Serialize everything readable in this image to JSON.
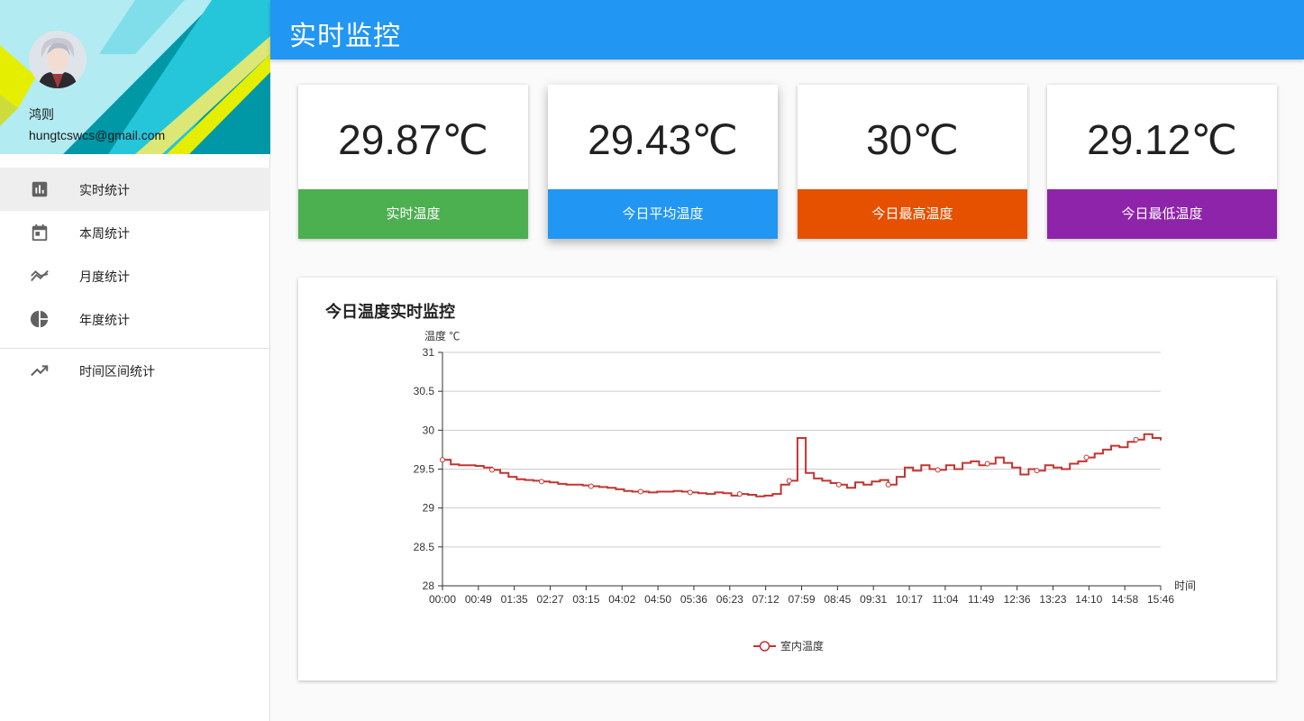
{
  "user": {
    "name": "鸿则",
    "email": "hungtcswcs@gmail.com"
  },
  "nav": [
    {
      "label": "实时统计",
      "icon": "bar-chart-icon",
      "active": true
    },
    {
      "label": "本周统计",
      "icon": "calendar-icon",
      "active": false
    },
    {
      "label": "月度统计",
      "icon": "multiline-chart-icon",
      "active": false
    },
    {
      "label": "年度统计",
      "icon": "pie-chart-icon",
      "active": false
    },
    {
      "label": "时间区间统计",
      "icon": "trending-up-icon",
      "active": false
    }
  ],
  "header": {
    "title": "实时监控"
  },
  "stats": [
    {
      "value": "29.87℃",
      "label": "实时温度",
      "color": "#4caf50"
    },
    {
      "value": "29.43℃",
      "label": "今日平均温度",
      "color": "#2196f3"
    },
    {
      "value": "30℃",
      "label": "今日最高温度",
      "color": "#e65100"
    },
    {
      "value": "29.12℃",
      "label": "今日最低温度",
      "color": "#8e24aa"
    }
  ],
  "chart": {
    "title": "今日温度实时监控"
  },
  "chart_data": {
    "type": "line",
    "ylabel": "温度 ℃",
    "xlabel": "时间",
    "ylim": [
      28,
      31
    ],
    "yticks": [
      "28",
      "28.5",
      "29",
      "29.5",
      "30",
      "30.5",
      "31"
    ],
    "xticks": [
      "00:00",
      "00:49",
      "01:35",
      "02:27",
      "03:15",
      "04:02",
      "04:50",
      "05:36",
      "06:23",
      "07:12",
      "07:59",
      "08:45",
      "09:31",
      "10:17",
      "11:04",
      "11:49",
      "12:36",
      "13:23",
      "14:10",
      "14:58",
      "15:46"
    ],
    "grid": true,
    "legend": "bottom-center",
    "series": [
      {
        "name": "室内温度",
        "color": "#c23531",
        "values": [
          29.62,
          29.56,
          29.55,
          29.55,
          29.54,
          29.52,
          29.49,
          29.45,
          29.4,
          29.37,
          29.36,
          29.35,
          29.34,
          29.33,
          29.31,
          29.3,
          29.3,
          29.29,
          29.28,
          29.27,
          29.26,
          29.24,
          29.22,
          29.21,
          29.21,
          29.2,
          29.21,
          29.21,
          29.22,
          29.21,
          29.2,
          29.19,
          29.18,
          29.2,
          29.19,
          29.16,
          29.18,
          29.17,
          29.15,
          29.16,
          29.18,
          29.3,
          29.35,
          29.9,
          29.45,
          29.38,
          29.35,
          29.32,
          29.3,
          29.26,
          29.33,
          29.3,
          29.34,
          29.36,
          29.3,
          29.4,
          29.52,
          29.48,
          29.55,
          29.5,
          29.49,
          29.55,
          29.5,
          29.58,
          29.6,
          29.55,
          29.57,
          29.65,
          29.58,
          29.52,
          29.43,
          29.5,
          29.48,
          29.55,
          29.52,
          29.5,
          29.57,
          29.6,
          29.65,
          29.7,
          29.75,
          29.8,
          29.78,
          29.85,
          29.88,
          29.95,
          29.9,
          29.87
        ]
      }
    ]
  }
}
